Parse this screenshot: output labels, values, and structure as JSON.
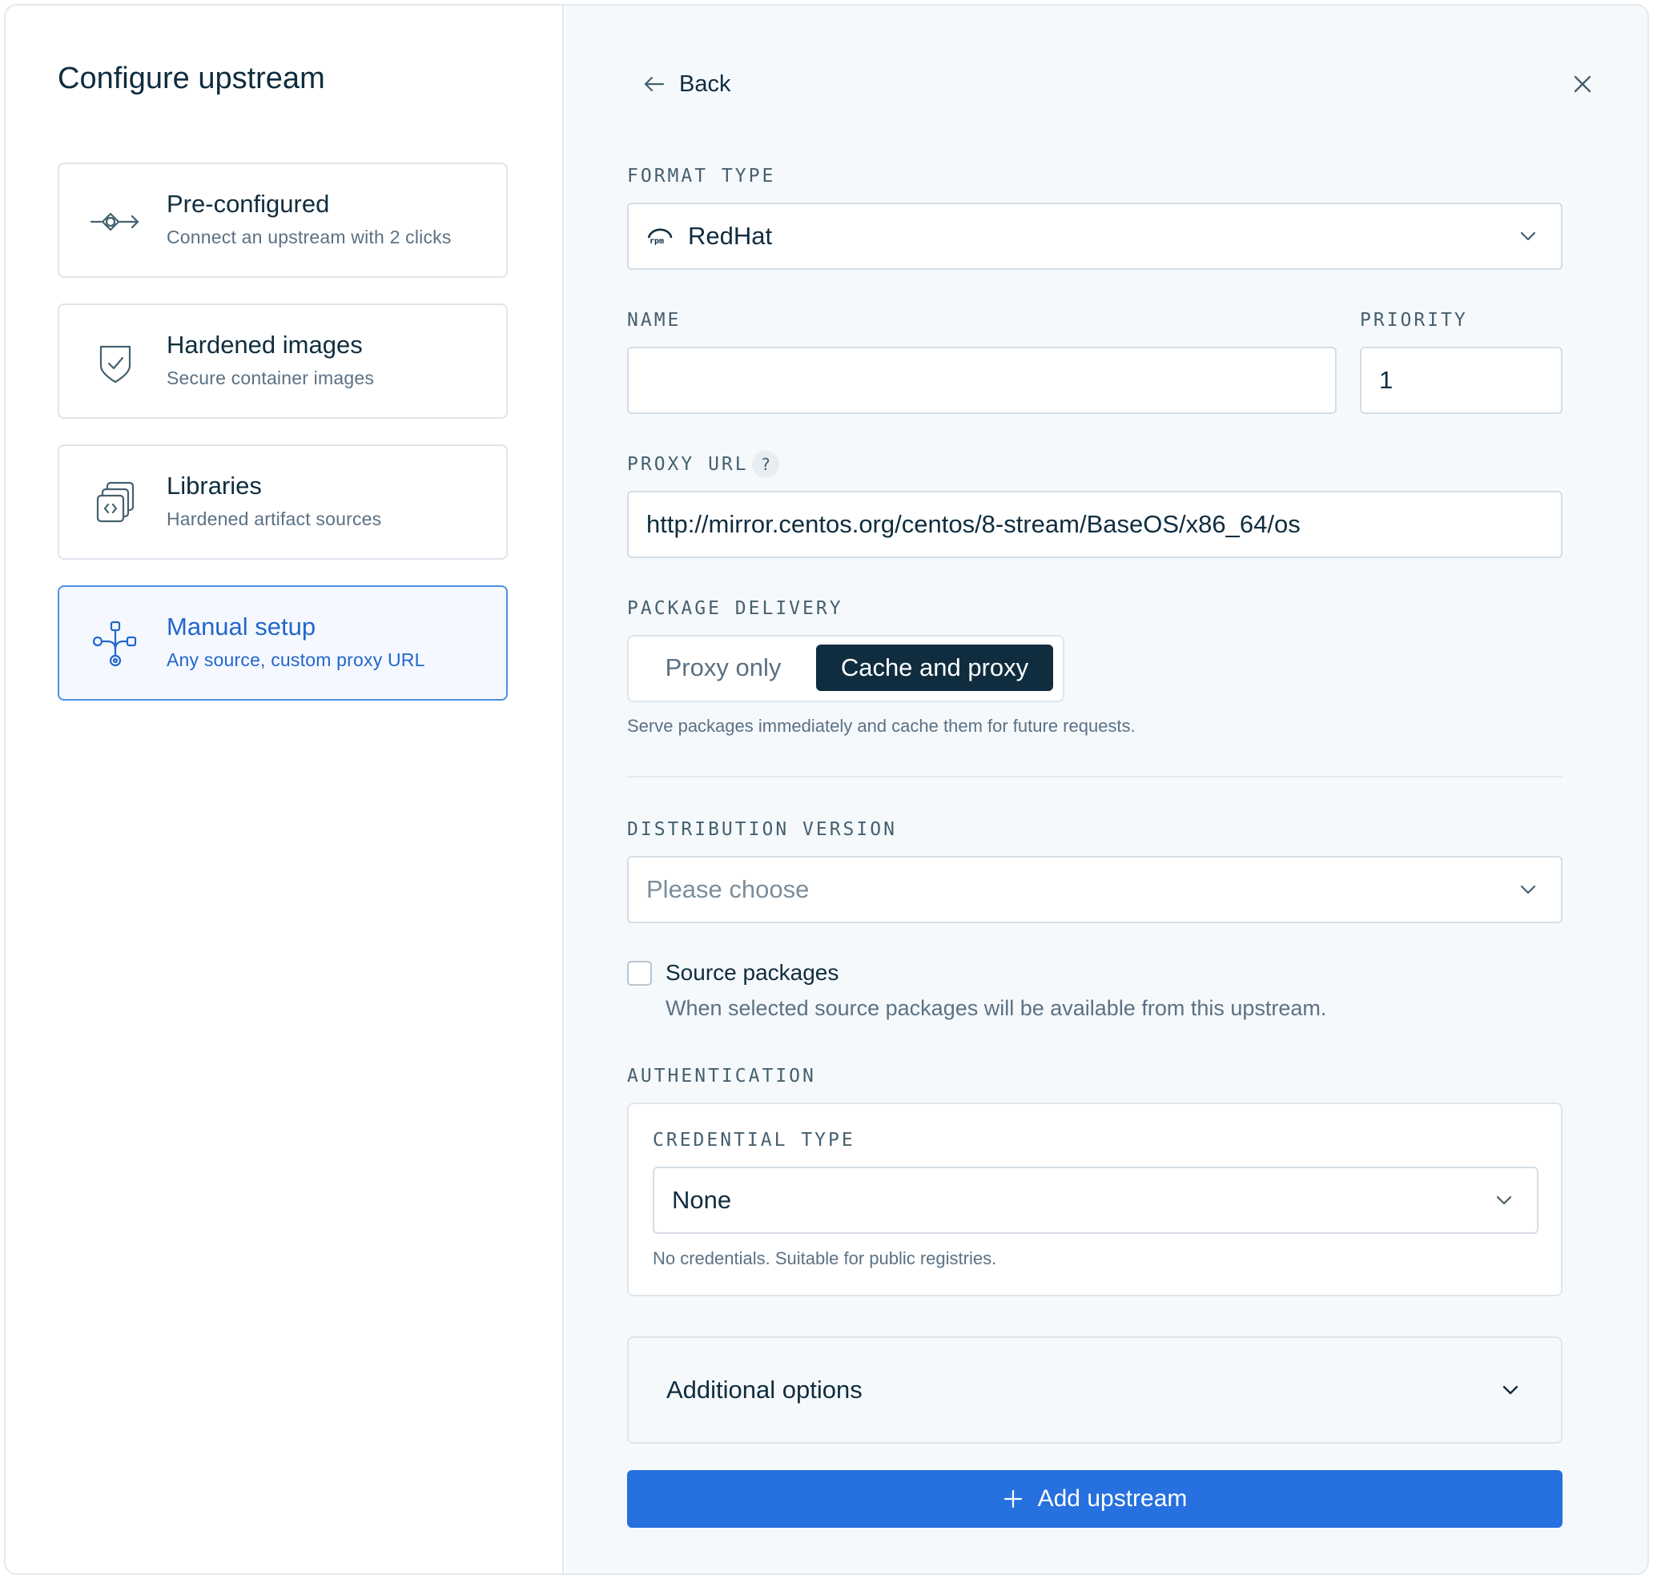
{
  "panel": {
    "title": "Configure upstream"
  },
  "options": [
    {
      "title": "Pre-configured",
      "desc": "Connect an upstream with 2 clicks",
      "icon": "target-arrow-icon"
    },
    {
      "title": "Hardened images",
      "desc": "Secure container images",
      "icon": "shield-check-icon"
    },
    {
      "title": "Libraries",
      "desc": "Hardened artifact sources",
      "icon": "stacked-code-icon"
    },
    {
      "title": "Manual setup",
      "desc": "Any source, custom proxy URL",
      "icon": "network-nodes-icon",
      "selected": true
    }
  ],
  "header": {
    "back_label": "Back"
  },
  "format_type": {
    "label": "FORMAT TYPE",
    "value": "RedHat",
    "icon": "rpm-icon"
  },
  "name": {
    "label": "NAME",
    "value": ""
  },
  "priority": {
    "label": "PRIORITY",
    "value": "1"
  },
  "proxy_url": {
    "label": "PROXY URL",
    "help": "?",
    "value": "http://mirror.centos.org/centos/8-stream/BaseOS/x86_64/os"
  },
  "package_delivery": {
    "label": "PACKAGE DELIVERY",
    "options": [
      "Proxy only",
      "Cache and proxy"
    ],
    "selected": "Cache and proxy",
    "hint": "Serve packages immediately and cache them for future requests."
  },
  "distribution_version": {
    "label": "DISTRIBUTION VERSION",
    "placeholder": "Please choose"
  },
  "source_packages": {
    "label": "Source packages",
    "desc": "When selected source packages will be available from this upstream.",
    "checked": false
  },
  "authentication": {
    "label": "AUTHENTICATION",
    "credential_type": {
      "label": "CREDENTIAL TYPE",
      "value": "None",
      "hint": "No credentials. Suitable for public registries."
    }
  },
  "additional_options": {
    "label": "Additional options"
  },
  "submit": {
    "label": "Add upstream"
  },
  "colors": {
    "accent": "#2670df",
    "selected_text": "#2266cc",
    "dark": "#0f2d3f"
  }
}
